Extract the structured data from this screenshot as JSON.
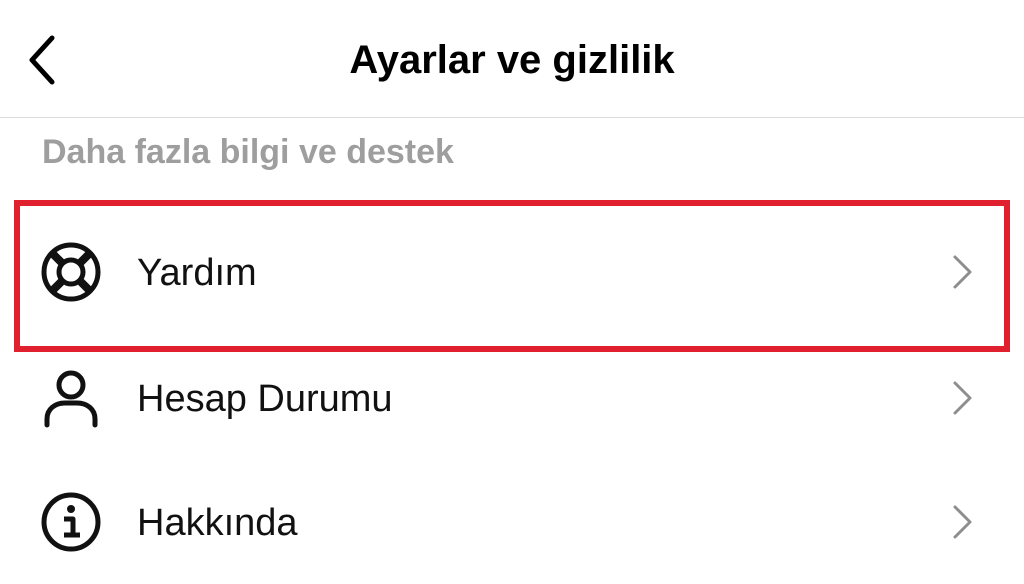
{
  "header": {
    "title": "Ayarlar ve gizlilik",
    "back_icon": "chevron-left-icon"
  },
  "section": {
    "title": "Daha fazla bilgi ve destek"
  },
  "items": [
    {
      "label": "Yardım",
      "icon": "lifebuoy-icon",
      "highlighted": true
    },
    {
      "label": "Hesap Durumu",
      "icon": "person-icon",
      "highlighted": false
    },
    {
      "label": "Hakkında",
      "icon": "info-icon",
      "highlighted": false
    }
  ],
  "colors": {
    "highlight_border": "#e0202e",
    "section_title": "#9e9e9e",
    "chevron": "#8e8e8e",
    "divider": "#dbdbdb"
  }
}
